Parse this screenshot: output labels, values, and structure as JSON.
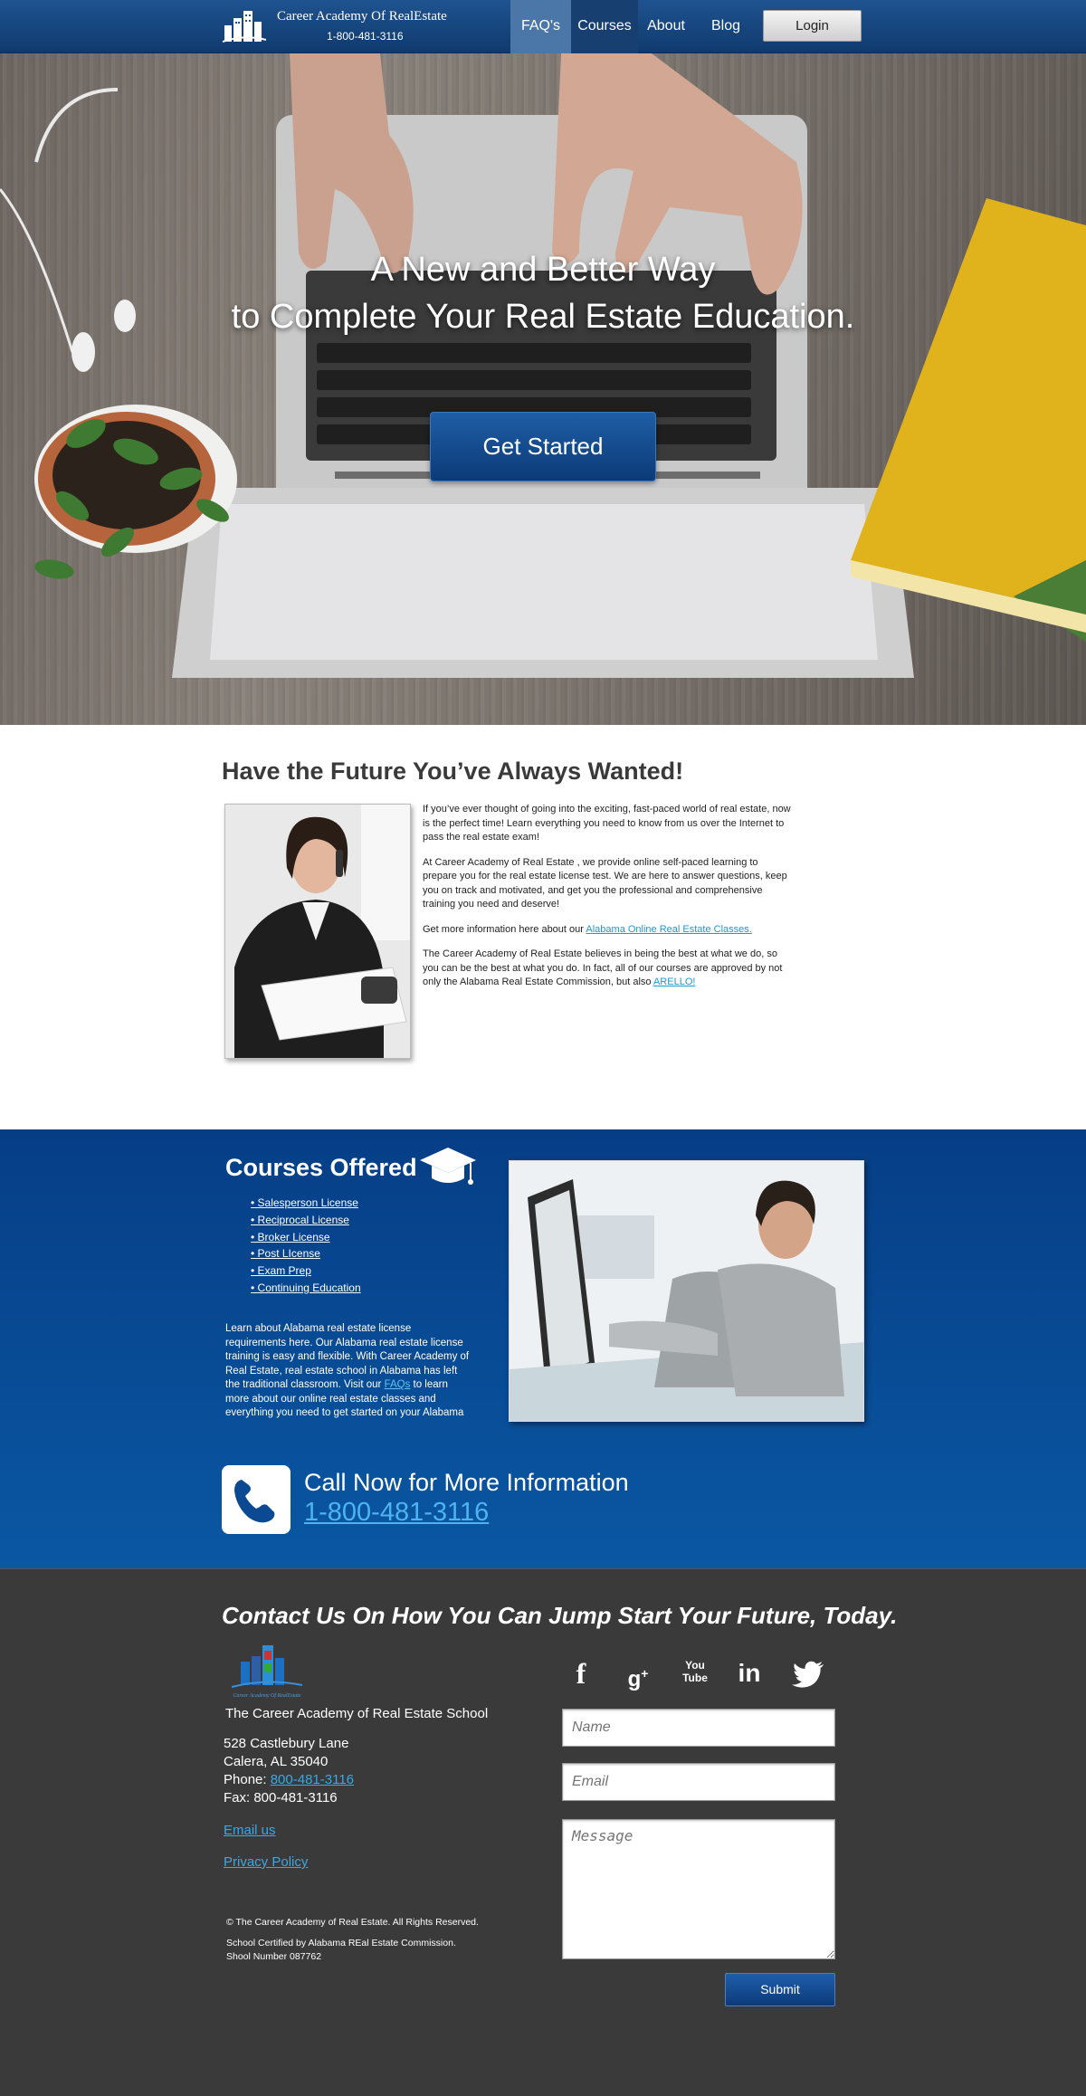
{
  "header": {
    "logo_name": "Career Academy Of RealEstate",
    "logo_phone": "1-800-481-3116",
    "nav": [
      "FAQ's",
      "Courses",
      "About",
      "Blog"
    ],
    "login_label": "Login",
    "active_nav": "FAQ's"
  },
  "hero": {
    "title_line1": "A New and Better Way",
    "title_line2": "to Complete Your Real Estate Education.",
    "cta_label": "Get Started"
  },
  "intro": {
    "heading": "Have the Future You’ve Always Wanted!",
    "p1": "If you’ve ever thought of going into the exciting, fast-paced world of real estate, now is the perfect time! Learn everything you need to know from us over the Internet to pass the real estate exam!",
    "p2": "At Career Academy of Real Estate , we provide online self-paced learning to prepare you for the real estate license test. We are here to answer questions, keep you on track and motivated, and get you the professional and comprehensive training you need and deserve!",
    "p3_text": "Get more information here about our ",
    "p3_link": "Alabama Online Real Estate Classes.",
    "p4_text": "The Career Academy of Real Estate believes in being the best at what we do, so you can be the best at what you do. In fact, all of our courses are approved by not only the Alabama Real Estate Commission, but also ",
    "p4_link": "ARELLO!"
  },
  "courses": {
    "heading": "Courses Offered",
    "items": [
      "• Salesperson License",
      "• Reciprocal License",
      "• Broker License",
      "• Post LIcense",
      "• Exam Prep",
      "• Continuing Education"
    ],
    "desc_before": "Learn about Alabama real estate license requirements here. Our Alabama real estate license training is easy and flexible. With Career Academy of Real Estate, real estate school in Alabama has left the traditional classroom. Visit our ",
    "desc_link": "FAQs",
    "desc_after": " to learn more about our online real estate classes and everything you need to get started on your Alabama",
    "call_title": "Call Now for More Information",
    "call_number": "1-800-481-3116"
  },
  "footer": {
    "heading": "Contact Us On How You Can Jump Start Your Future, Today.",
    "logo_text": "Career Academy Of RealEstate",
    "school_name": "The Career Academy of Real Estate School",
    "address1": "528 Castlebury Lane",
    "address2": "Calera, AL 35040",
    "phone_label": "Phone: ",
    "phone_link": "800-481-3116",
    "fax": "Fax: 800-481-3116",
    "email_link": "Email us",
    "privacy_link": "Privacy Policy",
    "copyright": "© The Career Academy of Real Estate. All Rights Reserved.",
    "certified": "School Certified by Alabama REal Estate Commission.",
    "school_number": "Shool Number 087762",
    "socials": [
      "facebook-icon",
      "google-plus-icon",
      "youtube-icon",
      "linkedin-icon",
      "twitter-icon"
    ],
    "youtube_text": "You Tube",
    "form": {
      "name_placeholder": "Name",
      "email_placeholder": "Email",
      "message_placeholder": "Message",
      "submit_label": "Submit"
    }
  },
  "colors": {
    "header_blue": "#1f5390",
    "courses_blue": "#0a57a3",
    "footer_bg": "#3b3a3b",
    "link_blue": "#1a9ad6"
  }
}
